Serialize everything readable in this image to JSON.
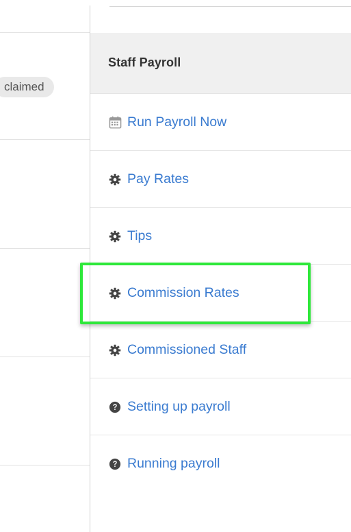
{
  "left": {
    "status_pill": "claimed"
  },
  "panel": {
    "title": "Staff Payroll",
    "items": [
      {
        "label": "Run Payroll Now",
        "icon": "calendar-icon"
      },
      {
        "label": "Pay Rates",
        "icon": "gear-icon"
      },
      {
        "label": "Tips",
        "icon": "gear-icon"
      },
      {
        "label": "Commission Rates",
        "icon": "gear-icon"
      },
      {
        "label": "Commissioned Staff",
        "icon": "gear-icon"
      },
      {
        "label": "Setting up payroll",
        "icon": "help-icon"
      },
      {
        "label": "Running payroll",
        "icon": "help-icon"
      }
    ]
  },
  "colors": {
    "link": "#3a7bd0",
    "icon": "#444444",
    "calendar_icon": "#999999",
    "highlight": "#2ee83a",
    "header_bg": "#f0f0f0"
  }
}
